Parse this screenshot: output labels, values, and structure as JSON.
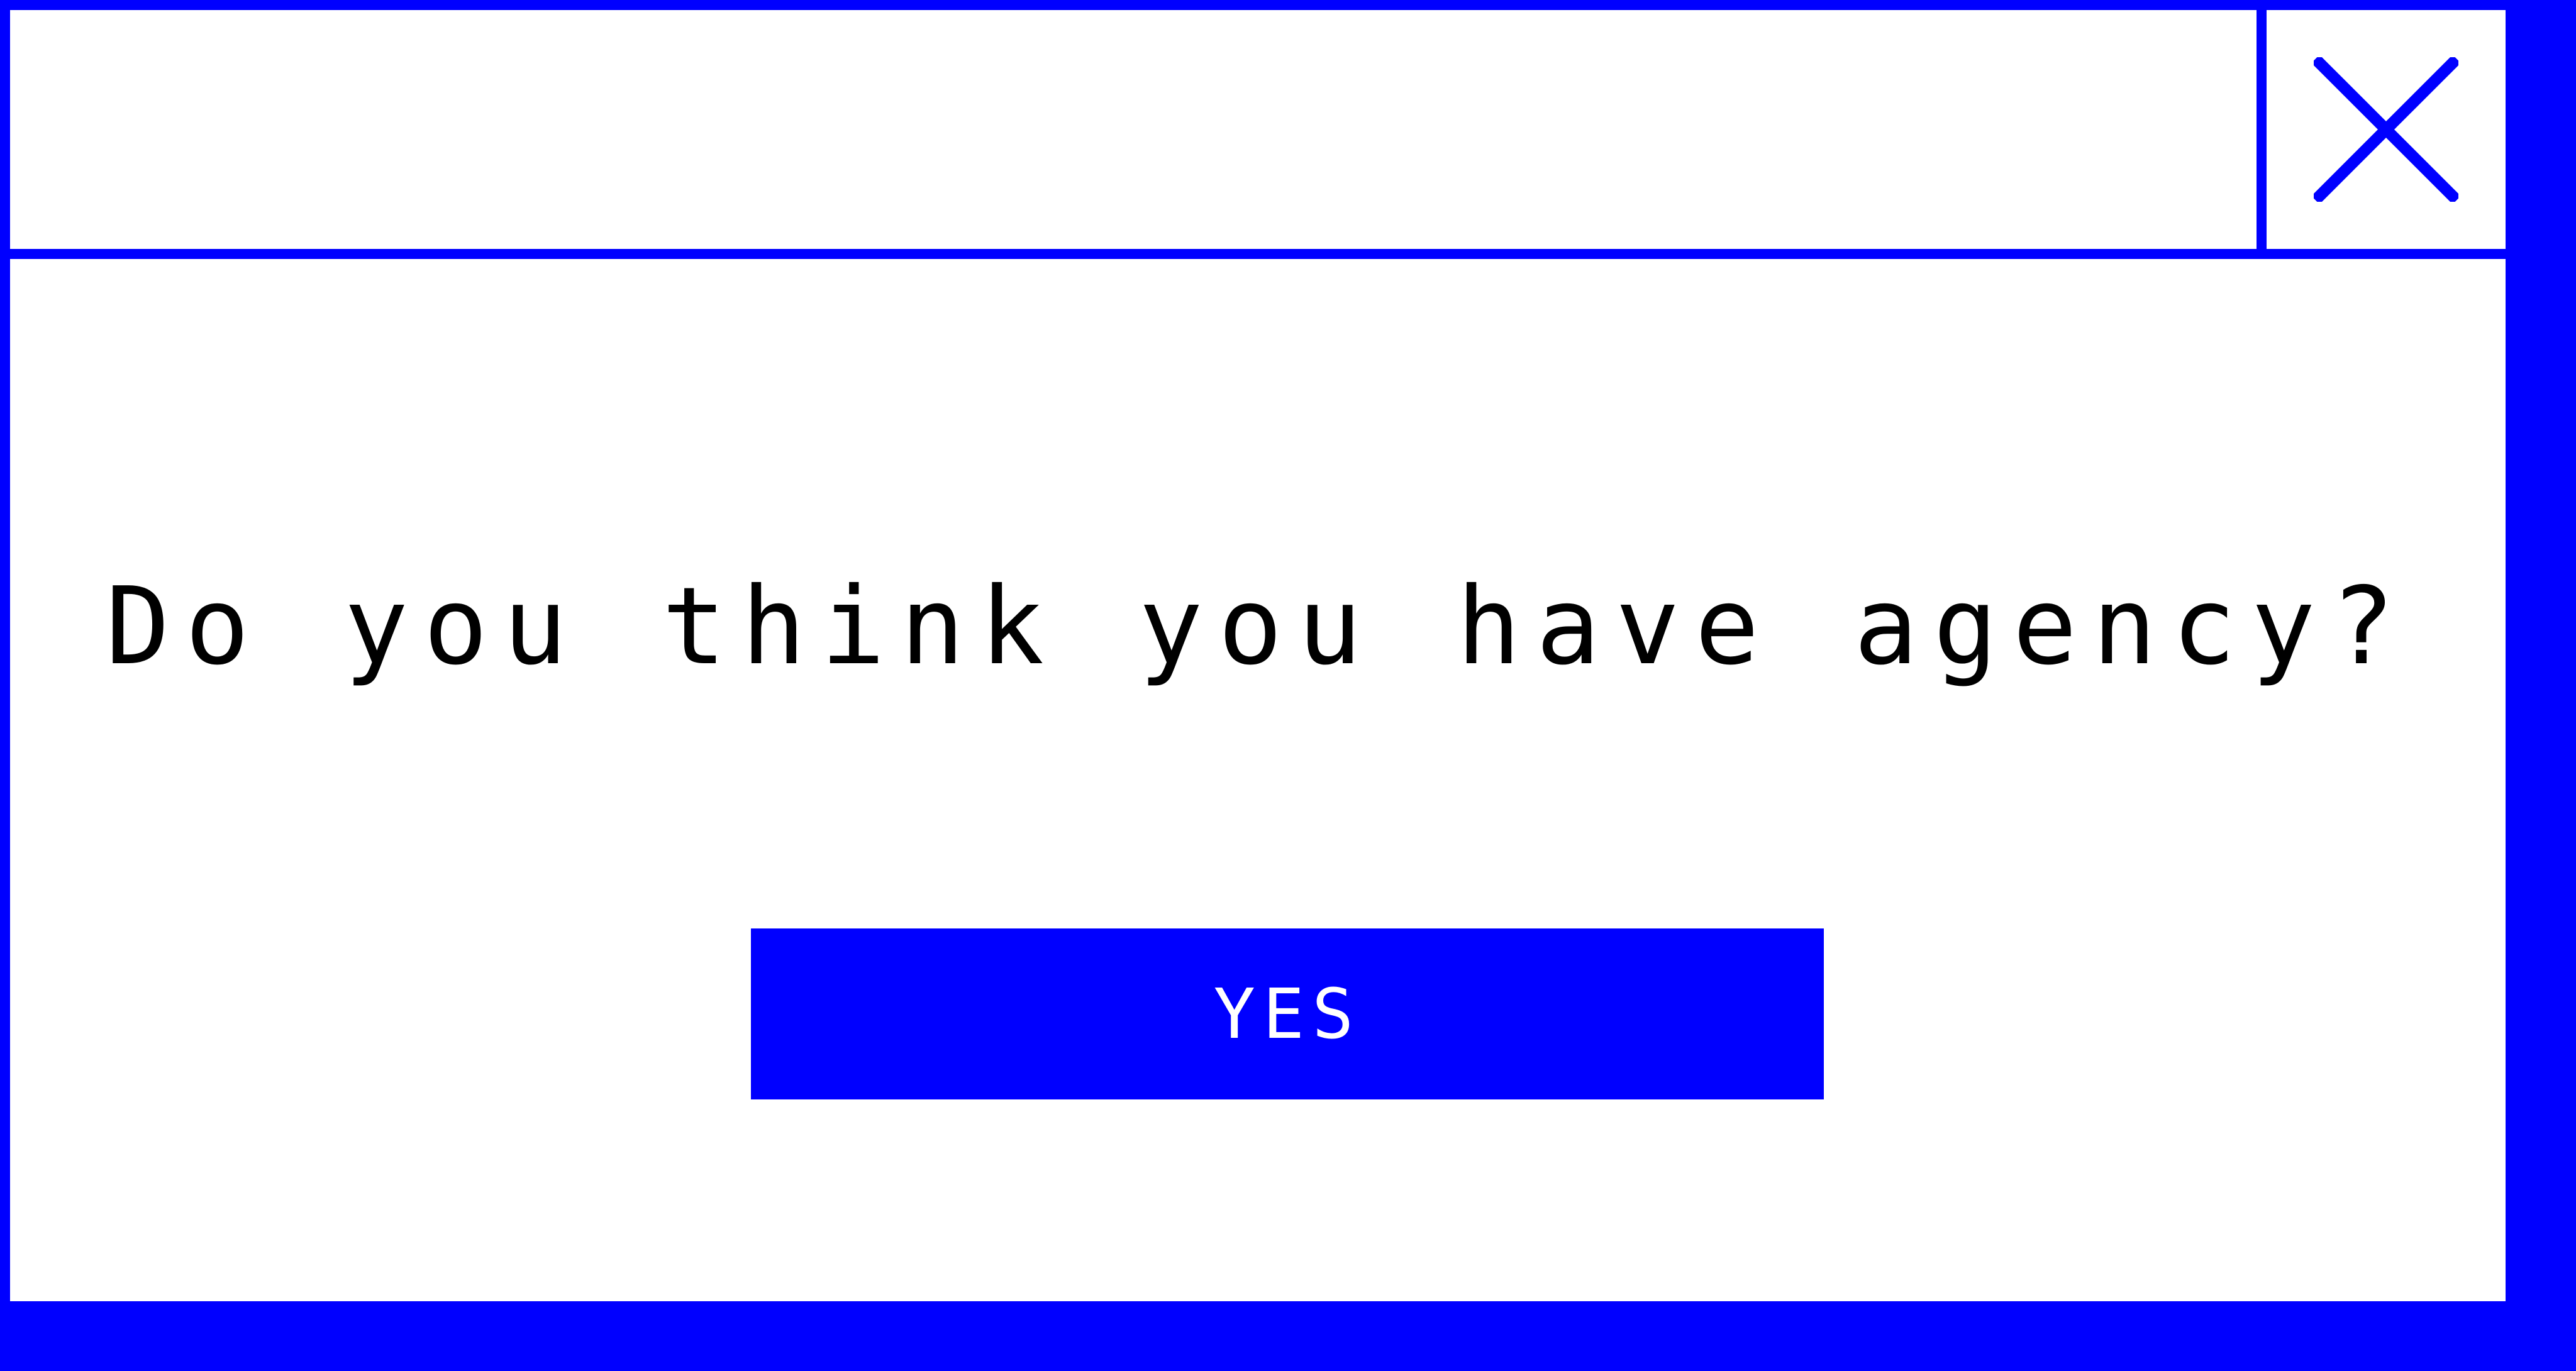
{
  "dialog": {
    "question": "Do you think you have agency?",
    "yes_label": "YES",
    "close_icon": "close-icon"
  },
  "colors": {
    "accent": "#0000ff",
    "background": "#ffffff",
    "text": "#000000",
    "button_text": "#ffffff"
  }
}
